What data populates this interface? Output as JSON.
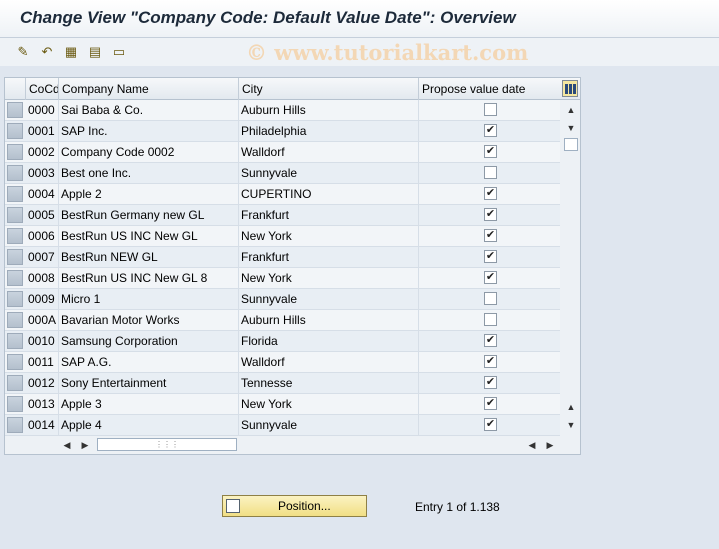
{
  "title": "Change View \"Company Code: Default Value Date\": Overview",
  "watermark": "© www.tutorialkart.com",
  "toolbar": {
    "icons": [
      "edit-icon",
      "undo-icon",
      "select-all-icon",
      "deselect-all-icon",
      "detail-icon"
    ]
  },
  "table": {
    "columns": [
      "CoCd",
      "Company Name",
      "City",
      "Propose value date"
    ],
    "rows": [
      {
        "cocd": "0000",
        "name": "Sai Baba & Co.",
        "city": "Auburn Hills",
        "propose": false
      },
      {
        "cocd": "0001",
        "name": "SAP Inc.",
        "city": "Philadelphia",
        "propose": true
      },
      {
        "cocd": "0002",
        "name": "Company Code 0002",
        "city": "Walldorf",
        "propose": true
      },
      {
        "cocd": "0003",
        "name": "Best one Inc.",
        "city": "Sunnyvale",
        "propose": false
      },
      {
        "cocd": "0004",
        "name": "Apple 2",
        "city": "CUPERTINO",
        "propose": true
      },
      {
        "cocd": "0005",
        "name": "BestRun Germany new GL",
        "city": "Frankfurt",
        "propose": true
      },
      {
        "cocd": "0006",
        "name": "BestRun US INC New GL",
        "city": "New York",
        "propose": true
      },
      {
        "cocd": "0007",
        "name": "BestRun NEW GL",
        "city": "Frankfurt",
        "propose": true
      },
      {
        "cocd": "0008",
        "name": "BestRun US INC New GL 8",
        "city": "New York",
        "propose": true
      },
      {
        "cocd": "0009",
        "name": "Micro 1",
        "city": "Sunnyvale",
        "propose": false
      },
      {
        "cocd": "000A",
        "name": "Bavarian Motor Works",
        "city": "Auburn Hills",
        "propose": false
      },
      {
        "cocd": "0010",
        "name": "Samsung Corporation",
        "city": "Florida",
        "propose": true
      },
      {
        "cocd": "0011",
        "name": "SAP A.G.",
        "city": "Walldorf",
        "propose": true
      },
      {
        "cocd": "0012",
        "name": "Sony Entertainment",
        "city": "Tennesse",
        "propose": true
      },
      {
        "cocd": "0013",
        "name": "Apple 3",
        "city": "New York",
        "propose": true
      },
      {
        "cocd": "0014",
        "name": "Apple 4",
        "city": "Sunnyvale",
        "propose": true
      }
    ]
  },
  "position_button": "Position...",
  "entry_text": "Entry 1 of 1.138"
}
